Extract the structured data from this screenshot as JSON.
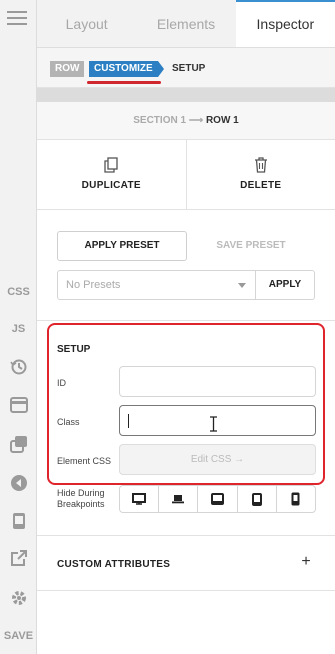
{
  "tabs": [
    {
      "label": "Layout"
    },
    {
      "label": "Elements"
    },
    {
      "label": "Inspector"
    }
  ],
  "rail": {
    "css_label": "CSS",
    "js_label": "JS",
    "save_label": "SAVE",
    "icons": [
      "menu-icon",
      "history-icon",
      "card-icon",
      "layers-icon",
      "back-icon",
      "device-icon",
      "external-icon",
      "gear-icon"
    ]
  },
  "breadcrumb": {
    "row": "ROW",
    "customize": "CUSTOMIZE",
    "setup": "SETUP"
  },
  "path": {
    "section": "SECTION 1",
    "arrow": "⟶",
    "row": "ROW 1"
  },
  "actions": {
    "duplicate": "DUPLICATE",
    "delete": "DELETE"
  },
  "presets": {
    "apply_preset": "APPLY PRESET",
    "save_preset": "SAVE PRESET",
    "selected": "No Presets",
    "apply": "APPLY"
  },
  "setup": {
    "title": "SETUP",
    "id_label": "ID",
    "id_value": "",
    "class_label": "Class",
    "class_value": "",
    "css_label": "Element CSS",
    "edit_css": "Edit CSS →",
    "hide_label": "Hide During Breakpoints"
  },
  "custom_attributes": {
    "title": "CUSTOM ATTRIBUTES",
    "add": "+"
  },
  "colors": {
    "accent": "#2b7fc2",
    "highlight": "#e0242c"
  }
}
